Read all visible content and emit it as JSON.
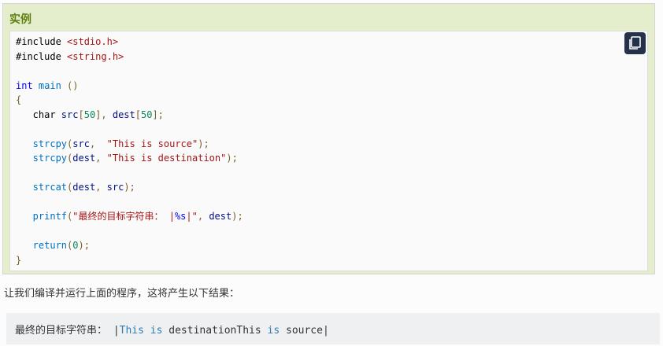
{
  "section": {
    "title": "实例"
  },
  "code_lines": [
    [
      {
        "t": "#include ",
        "c": "include"
      },
      {
        "t": "<stdio.h>",
        "c": "header"
      }
    ],
    [
      {
        "t": "#include ",
        "c": "include"
      },
      {
        "t": "<string.h>",
        "c": "header"
      }
    ],
    [],
    [
      {
        "t": "int",
        "c": "type"
      },
      {
        "t": " ",
        "c": "plain"
      },
      {
        "t": "main",
        "c": "func"
      },
      {
        "t": " ()",
        "c": "punct"
      }
    ],
    [
      {
        "t": "{",
        "c": "punct"
      }
    ],
    [
      {
        "t": "   char ",
        "c": "plain"
      },
      {
        "t": "src",
        "c": "var"
      },
      {
        "t": "[",
        "c": "punct"
      },
      {
        "t": "50",
        "c": "num"
      },
      {
        "t": "], ",
        "c": "punct"
      },
      {
        "t": "dest",
        "c": "var"
      },
      {
        "t": "[",
        "c": "punct"
      },
      {
        "t": "50",
        "c": "num"
      },
      {
        "t": "];",
        "c": "punct"
      }
    ],
    [],
    [
      {
        "t": "   strcpy",
        "c": "func"
      },
      {
        "t": "(",
        "c": "punct"
      },
      {
        "t": "src",
        "c": "var"
      },
      {
        "t": ",  ",
        "c": "punct"
      },
      {
        "t": "\"This is source\"",
        "c": "str"
      },
      {
        "t": ");",
        "c": "punct"
      }
    ],
    [
      {
        "t": "   strcpy",
        "c": "func"
      },
      {
        "t": "(",
        "c": "punct"
      },
      {
        "t": "dest",
        "c": "var"
      },
      {
        "t": ", ",
        "c": "punct"
      },
      {
        "t": "\"This is destination\"",
        "c": "str"
      },
      {
        "t": ");",
        "c": "punct"
      }
    ],
    [],
    [
      {
        "t": "   strcat",
        "c": "func"
      },
      {
        "t": "(",
        "c": "punct"
      },
      {
        "t": "dest",
        "c": "var"
      },
      {
        "t": ", ",
        "c": "punct"
      },
      {
        "t": "src",
        "c": "var"
      },
      {
        "t": ");",
        "c": "punct"
      }
    ],
    [],
    [
      {
        "t": "   printf",
        "c": "func"
      },
      {
        "t": "(",
        "c": "punct"
      },
      {
        "t": "\"最终的目标字符串： |",
        "c": "str"
      },
      {
        "t": "%s",
        "c": "fmt"
      },
      {
        "t": "|\"",
        "c": "str"
      },
      {
        "t": ", ",
        "c": "punct"
      },
      {
        "t": "dest",
        "c": "var"
      },
      {
        "t": ");",
        "c": "punct"
      }
    ],
    [],
    [
      {
        "t": "   return",
        "c": "func"
      },
      {
        "t": "(",
        "c": "punct"
      },
      {
        "t": "0",
        "c": "num"
      },
      {
        "t": ");",
        "c": "punct"
      }
    ],
    [
      {
        "t": "}",
        "c": "punct"
      }
    ]
  ],
  "copy_button": {
    "icon": "copy-icon"
  },
  "description": "让我们编译并运行上面的程序，这将产生以下结果：",
  "result": [
    {
      "t": "最终的目标字符串： |",
      "c": "plain"
    },
    {
      "t": "This",
      "c": "kw"
    },
    {
      "t": " ",
      "c": "plain"
    },
    {
      "t": "is",
      "c": "kw"
    },
    {
      "t": " destinationThis ",
      "c": "plain"
    },
    {
      "t": "is",
      "c": "kw"
    },
    {
      "t": " source|",
      "c": "plain"
    }
  ]
}
